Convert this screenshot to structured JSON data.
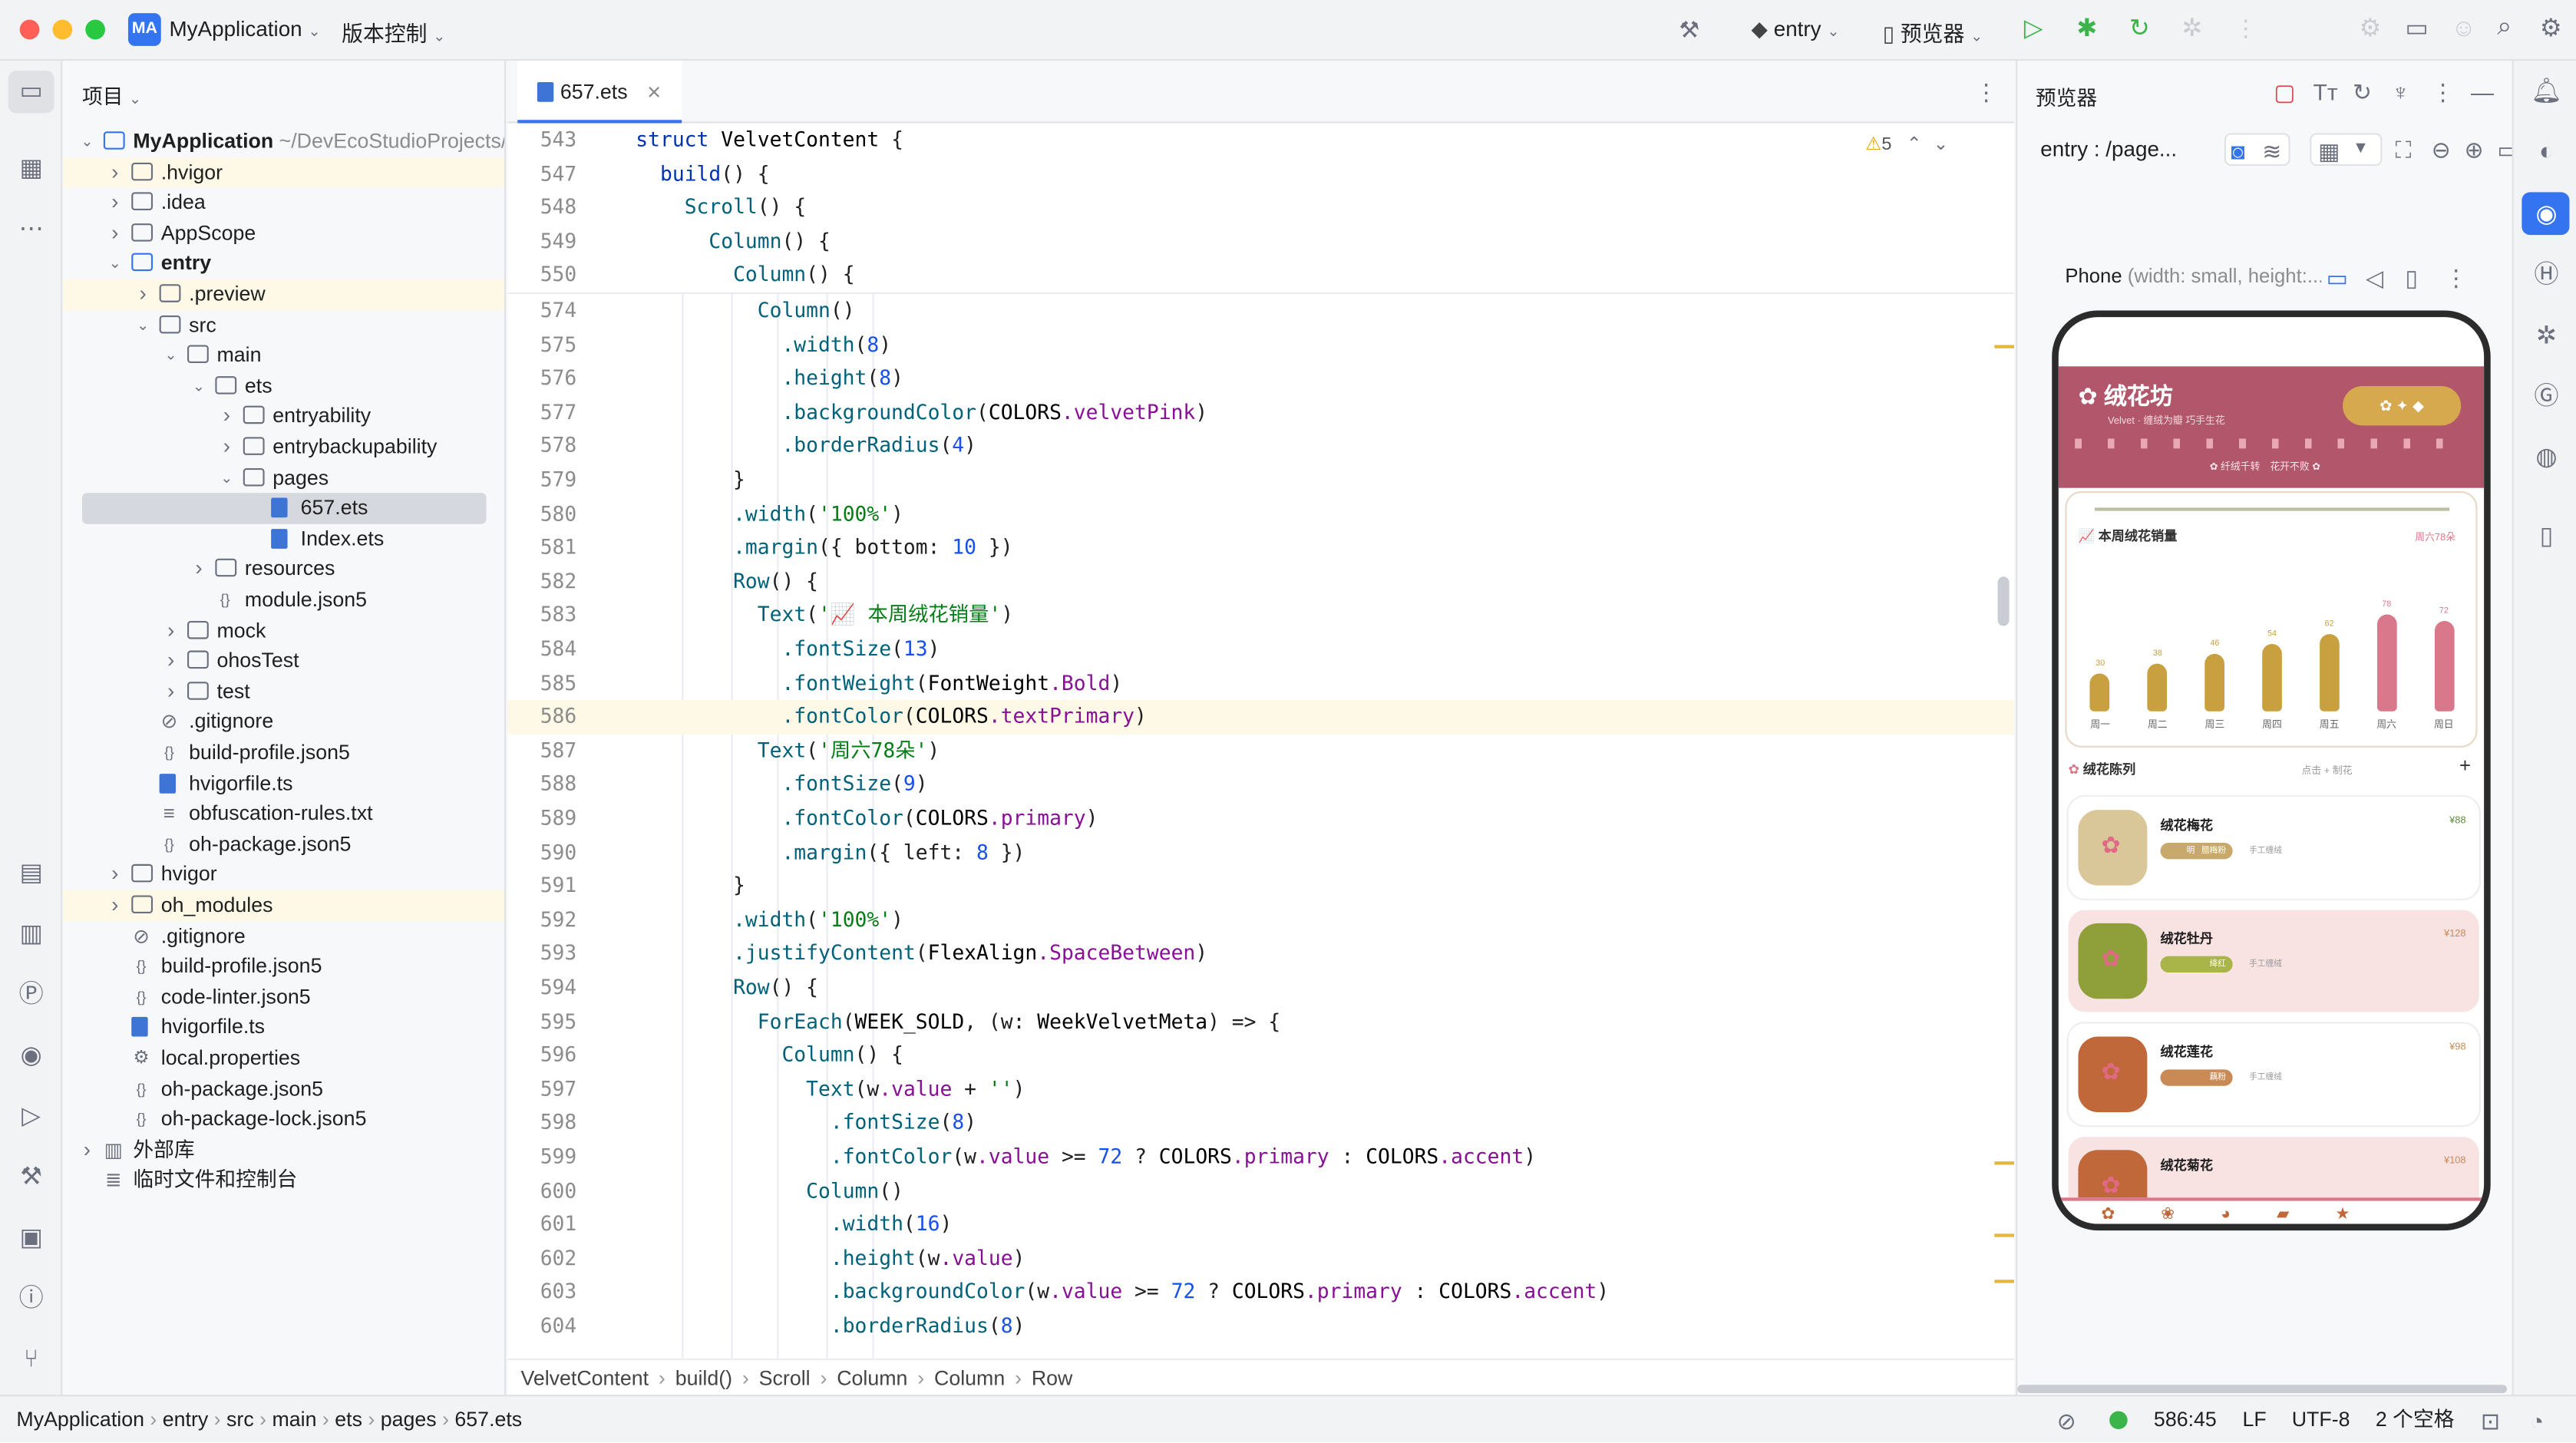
{
  "titlebar": {
    "app_badge": "MA",
    "project_name": "MyApplication",
    "vcs": "版本控制",
    "run_target": "entry",
    "previewer": "预览器"
  },
  "project_panel": {
    "title": "项目",
    "rows": [
      {
        "depth": 0,
        "arrow": "v",
        "icon": "module",
        "label": "MyApplication",
        "suffix": " ~/DevEcoStudioProjects/M",
        "bold": true
      },
      {
        "depth": 1,
        "arrow": ">",
        "icon": "folder",
        "label": ".hvigor",
        "hl": true
      },
      {
        "depth": 1,
        "arrow": ">",
        "icon": "folder",
        "label": ".idea"
      },
      {
        "depth": 1,
        "arrow": ">",
        "icon": "folder",
        "label": "AppScope"
      },
      {
        "depth": 1,
        "arrow": "v",
        "icon": "module",
        "label": "entry",
        "bold": true
      },
      {
        "depth": 2,
        "arrow": ">",
        "icon": "folder",
        "label": ".preview",
        "hl": true
      },
      {
        "depth": 2,
        "arrow": "v",
        "icon": "folder",
        "label": "src"
      },
      {
        "depth": 3,
        "arrow": "v",
        "icon": "folder",
        "label": "main"
      },
      {
        "depth": 4,
        "arrow": "v",
        "icon": "folder",
        "label": "ets"
      },
      {
        "depth": 5,
        "arrow": ">",
        "icon": "folder",
        "label": "entryability"
      },
      {
        "depth": 5,
        "arrow": ">",
        "icon": "folder",
        "label": "entrybackupability"
      },
      {
        "depth": 5,
        "arrow": "v",
        "icon": "folder",
        "label": "pages"
      },
      {
        "depth": 6,
        "arrow": "",
        "icon": "ets",
        "label": "657.ets",
        "sel": true
      },
      {
        "depth": 6,
        "arrow": "",
        "icon": "ets",
        "label": "Index.ets"
      },
      {
        "depth": 4,
        "arrow": ">",
        "icon": "folder",
        "label": "resources"
      },
      {
        "depth": 4,
        "arrow": "",
        "icon": "json",
        "label": "module.json5"
      },
      {
        "depth": 3,
        "arrow": ">",
        "icon": "folder",
        "label": "mock"
      },
      {
        "depth": 3,
        "arrow": ">",
        "icon": "folder",
        "label": "ohosTest"
      },
      {
        "depth": 3,
        "arrow": ">",
        "icon": "folder",
        "label": "test"
      },
      {
        "depth": 2,
        "arrow": "",
        "icon": "ignore",
        "label": ".gitignore"
      },
      {
        "depth": 2,
        "arrow": "",
        "icon": "json",
        "label": "build-profile.json5"
      },
      {
        "depth": 2,
        "arrow": "",
        "icon": "ts",
        "label": "hvigorfile.ts"
      },
      {
        "depth": 2,
        "arrow": "",
        "icon": "text",
        "label": "obfuscation-rules.txt"
      },
      {
        "depth": 2,
        "arrow": "",
        "icon": "json",
        "label": "oh-package.json5"
      },
      {
        "depth": 1,
        "arrow": ">",
        "icon": "folder",
        "label": "hvigor"
      },
      {
        "depth": 1,
        "arrow": ">",
        "icon": "folder",
        "label": "oh_modules",
        "hl": true
      },
      {
        "depth": 1,
        "arrow": "",
        "icon": "ignore",
        "label": ".gitignore"
      },
      {
        "depth": 1,
        "arrow": "",
        "icon": "json",
        "label": "build-profile.json5"
      },
      {
        "depth": 1,
        "arrow": "",
        "icon": "json",
        "label": "code-linter.json5"
      },
      {
        "depth": 1,
        "arrow": "",
        "icon": "ts",
        "label": "hvigorfile.ts"
      },
      {
        "depth": 1,
        "arrow": "",
        "icon": "gear",
        "label": "local.properties"
      },
      {
        "depth": 1,
        "arrow": "",
        "icon": "json",
        "label": "oh-package.json5"
      },
      {
        "depth": 1,
        "arrow": "",
        "icon": "json",
        "label": "oh-package-lock.json5"
      },
      {
        "depth": 0,
        "arrow": ">",
        "icon": "lib",
        "label": "外部库"
      },
      {
        "depth": 0,
        "arrow": "",
        "icon": "console",
        "label": "临时文件和控制台"
      }
    ]
  },
  "editor": {
    "tab_label": "657.ets",
    "warning_count": "5",
    "sticky_lines": [
      {
        "n": "543",
        "t": "struct VelvetContent {"
      },
      {
        "n": "547",
        "t": "  build() {"
      },
      {
        "n": "548",
        "t": "    Scroll() {"
      },
      {
        "n": "549",
        "t": "      Column() {"
      },
      {
        "n": "550",
        "t": "        Column() {"
      }
    ],
    "lines": [
      {
        "n": "574",
        "t": "          Column()"
      },
      {
        "n": "575",
        "t": "            .width(8)"
      },
      {
        "n": "576",
        "t": "            .height(8)"
      },
      {
        "n": "577",
        "t": "            .backgroundColor(COLORS.velvetPink)"
      },
      {
        "n": "578",
        "t": "            .borderRadius(4)"
      },
      {
        "n": "579",
        "t": "        }"
      },
      {
        "n": "580",
        "t": "        .width('100%')"
      },
      {
        "n": "581",
        "t": "        .margin({ bottom: 10 })"
      },
      {
        "n": "582",
        "t": "        Row() {"
      },
      {
        "n": "583",
        "t": "          Text('📈 本周绒花销量')"
      },
      {
        "n": "584",
        "t": "            .fontSize(13)"
      },
      {
        "n": "585",
        "t": "            .fontWeight(FontWeight.Bold)"
      },
      {
        "n": "586",
        "t": "            .fontColor(COLORS.textPrimary)",
        "cur": true
      },
      {
        "n": "587",
        "t": "          Text('周六78朵')"
      },
      {
        "n": "588",
        "t": "            .fontSize(9)"
      },
      {
        "n": "589",
        "t": "            .fontColor(COLORS.primary)"
      },
      {
        "n": "590",
        "t": "            .margin({ left: 8 })"
      },
      {
        "n": "591",
        "t": "        }"
      },
      {
        "n": "592",
        "t": "        .width('100%')"
      },
      {
        "n": "593",
        "t": "        .justifyContent(FlexAlign.SpaceBetween)"
      },
      {
        "n": "594",
        "t": "        Row() {"
      },
      {
        "n": "595",
        "t": "          ForEach(WEEK_SOLD, (w: WeekVelvetMeta) => {"
      },
      {
        "n": "596",
        "t": "            Column() {"
      },
      {
        "n": "597",
        "t": "              Text(w.value + '')"
      },
      {
        "n": "598",
        "t": "                .fontSize(8)"
      },
      {
        "n": "599",
        "t": "                .fontColor(w.value >= 72 ? COLORS.primary : COLORS.accent)"
      },
      {
        "n": "600",
        "t": "              Column()"
      },
      {
        "n": "601",
        "t": "                .width(16)"
      },
      {
        "n": "602",
        "t": "                .height(w.value)"
      },
      {
        "n": "603",
        "t": "                .backgroundColor(w.value >= 72 ? COLORS.primary : COLORS.accent)"
      },
      {
        "n": "604",
        "t": "                .borderRadius(8)"
      }
    ],
    "breadcrumb": [
      "VelvetContent",
      "build()",
      "Scroll",
      "Column",
      "Column",
      "Row"
    ]
  },
  "previewer": {
    "panel_title": "预览器",
    "route": "entry : /page...",
    "device": "Phone",
    "device_suffix": " (width: small, height:...",
    "app": {
      "title": "绒花坊",
      "subtitle": "Velvet · 缠绒为瓣 巧手生花",
      "banner_left": "纤绒千转",
      "banner_right": "花开不败",
      "chart_title": "本周绒花销量",
      "chart_note": "周六78朵",
      "list_title": "绒花陈列",
      "list_hint": "点击 + 制花",
      "items": [
        {
          "name": "绒花梅花",
          "price": "¥88",
          "tag1": "明",
          "tag2": "腊梅粉",
          "tag3": "手工缠绒",
          "bg": "#ffffff",
          "thumb": "#d9c79a",
          "tagc": "#c7a96b"
        },
        {
          "name": "绒花牡丹",
          "price": "¥128",
          "tag1": "",
          "tag2": "绛红",
          "tag3": "手工缠绒",
          "bg": "#f8e2e2",
          "thumb": "#8fa03a",
          "tagc": "#a9b548"
        },
        {
          "name": "绒花莲花",
          "price": "¥98",
          "tag1": "",
          "tag2": "藕粉",
          "tag3": "手工缠绒",
          "bg": "#ffffff",
          "thumb": "#c0683a",
          "tagc": "#c98a55"
        },
        {
          "name": "绒花菊花",
          "price": "¥108",
          "tag1": "",
          "tag2": "",
          "tag3": "",
          "bg": "#f8e2e2",
          "thumb": "#c0683a",
          "tagc": "#c98a55"
        }
      ]
    }
  },
  "chart_data": {
    "type": "bar",
    "title": "本周绒花销量",
    "categories": [
      "周一",
      "周二",
      "周三",
      "周四",
      "周五",
      "周六",
      "周日"
    ],
    "values": [
      30,
      38,
      46,
      54,
      62,
      78,
      72
    ],
    "threshold": 72,
    "colors": {
      "accent": "#c9a03f",
      "primary": "#d9788a"
    }
  },
  "statusbar": {
    "path": [
      "MyApplication",
      "entry",
      "src",
      "main",
      "ets",
      "pages",
      "657.ets"
    ],
    "position": "586:45",
    "line_sep": "LF",
    "encoding": "UTF-8",
    "indent": "2 个空格"
  }
}
